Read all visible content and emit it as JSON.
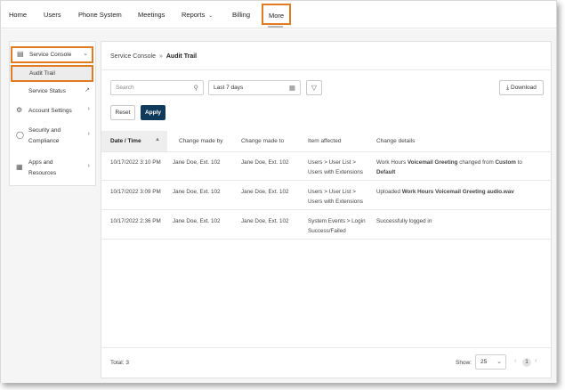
{
  "nav": {
    "items": [
      "Home",
      "Users",
      "Phone System",
      "Meetings",
      "Reports",
      "Billing",
      "More"
    ]
  },
  "sidebar": {
    "items": [
      {
        "label": "Service Console",
        "icon": "laptop-icon"
      },
      {
        "label": "Audit Trail"
      },
      {
        "label": "Service Status",
        "icon": "external-link-icon"
      },
      {
        "label": "Account Settings",
        "icon": "gear-icon"
      },
      {
        "label_line1": "Security and",
        "label_line2": "Compliance",
        "icon": "shield-icon"
      },
      {
        "label_line1": "Apps and",
        "label_line2": "Resources",
        "icon": "grid-icon"
      }
    ]
  },
  "breadcrumb": {
    "parent": "Service Console",
    "current": "Audit Trail",
    "separator": "»"
  },
  "filters": {
    "search_placeholder": "Search",
    "date_range": "Last 7 days",
    "download_label": "Download",
    "reset_label": "Reset",
    "apply_label": "Apply"
  },
  "table": {
    "columns": [
      "Date / Time",
      "Change made by",
      "Change made to",
      "Item affected",
      "Change details"
    ],
    "rows": [
      {
        "datetime": "10/17/2022 3:10 PM",
        "by": "Jane Doe, Ext. 102",
        "to": "Jane Doe, Ext. 102",
        "item_line1": "Users > User List >",
        "item_line2": "Users with Extensions",
        "details_a": "Work Hours ",
        "details_b": "Voicemail Greeting",
        "details_c": " changed from ",
        "details_d": "Custom",
        "details_e": " to",
        "details_f": "Default"
      },
      {
        "datetime": "10/17/2022 3:09 PM",
        "by": "Jane Doe, Ext. 102",
        "to": "Jane Doe, Ext. 102",
        "item_line1": "Users > User List >",
        "item_line2": "Users with Extensions",
        "details_a": "Uploaded ",
        "details_b": "Work Hours Voicemail Greeting audio.wav"
      },
      {
        "datetime": "10/17/2022 2:36 PM",
        "by": "Jane Doe, Ext. 102",
        "to": "Jane Doe, Ext. 102",
        "item_line1": "System Events > Login",
        "item_line2": "Success/Failed",
        "details_a": "Successfully logged in"
      }
    ]
  },
  "footer": {
    "total": "Total: 3",
    "show_label": "Show:",
    "page_size": "25",
    "current_page": "1"
  },
  "colors": {
    "highlight": "#e07b22",
    "primary": "#0f3a5c"
  }
}
